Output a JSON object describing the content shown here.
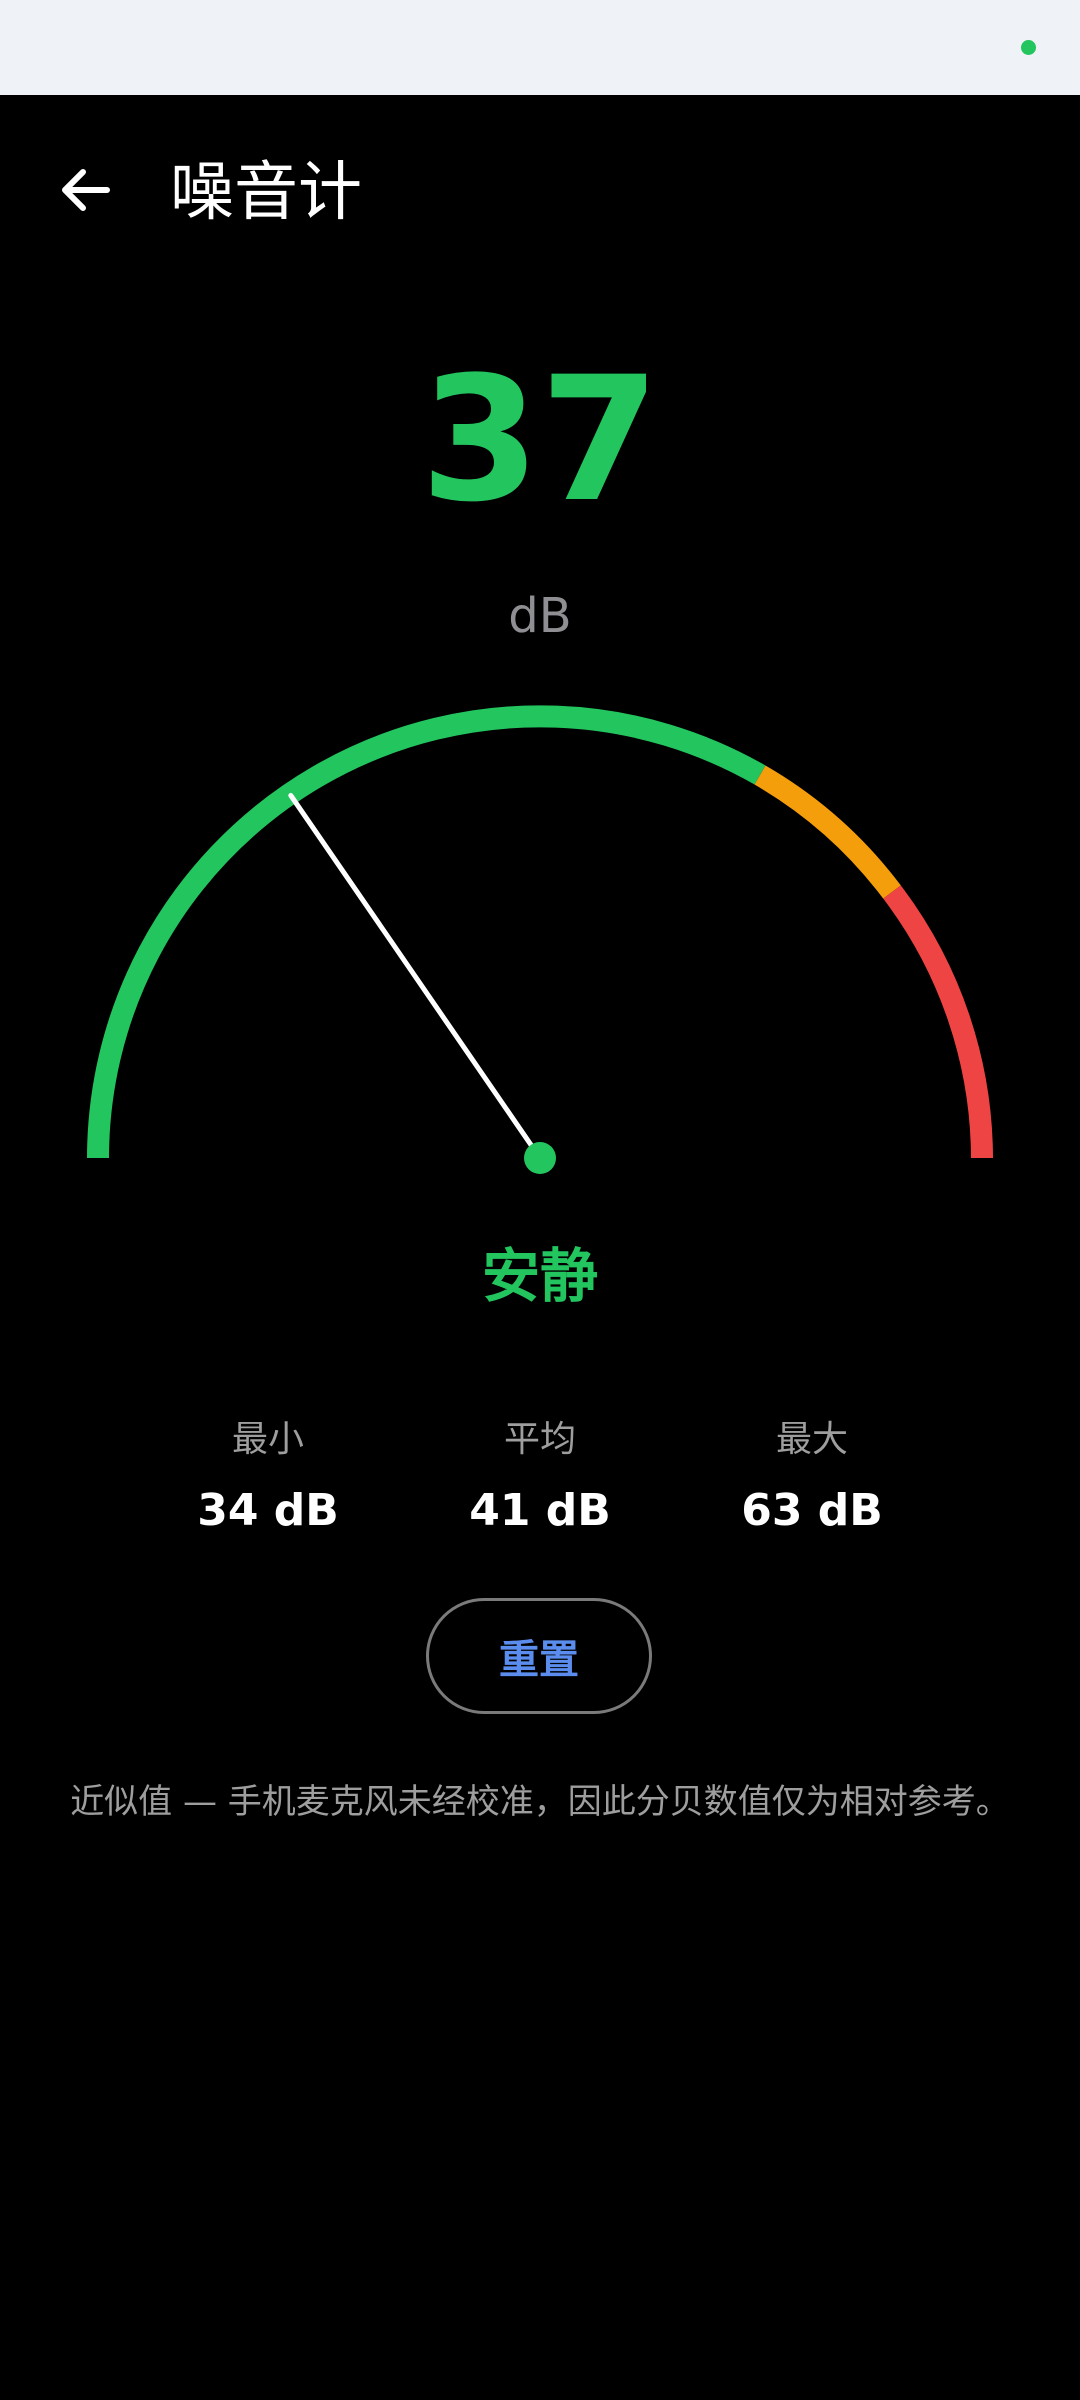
{
  "status_bar": {
    "indicator_color": "#22c55e"
  },
  "app_bar": {
    "back_icon": "arrow-left-icon",
    "title": "噪音计"
  },
  "reading": {
    "value": "37",
    "unit": "dB",
    "level_label": "安静",
    "color": "#22c55e"
  },
  "gauge": {
    "current_db": 37,
    "needle_color": "#ffffff",
    "segments": [
      {
        "color": "#22c55e"
      },
      {
        "color": "#f59e0b"
      },
      {
        "color": "#ef4444"
      }
    ]
  },
  "stats": {
    "min": {
      "label": "最小",
      "value": "34 dB"
    },
    "avg": {
      "label": "平均",
      "value": "41 dB"
    },
    "max": {
      "label": "最大",
      "value": "63 dB"
    }
  },
  "reset_button": {
    "label": "重置",
    "color": "#5b8def"
  },
  "disclaimer": "近似值 — 手机麦克风未经校准，因此分贝数值仅为相对参考。"
}
